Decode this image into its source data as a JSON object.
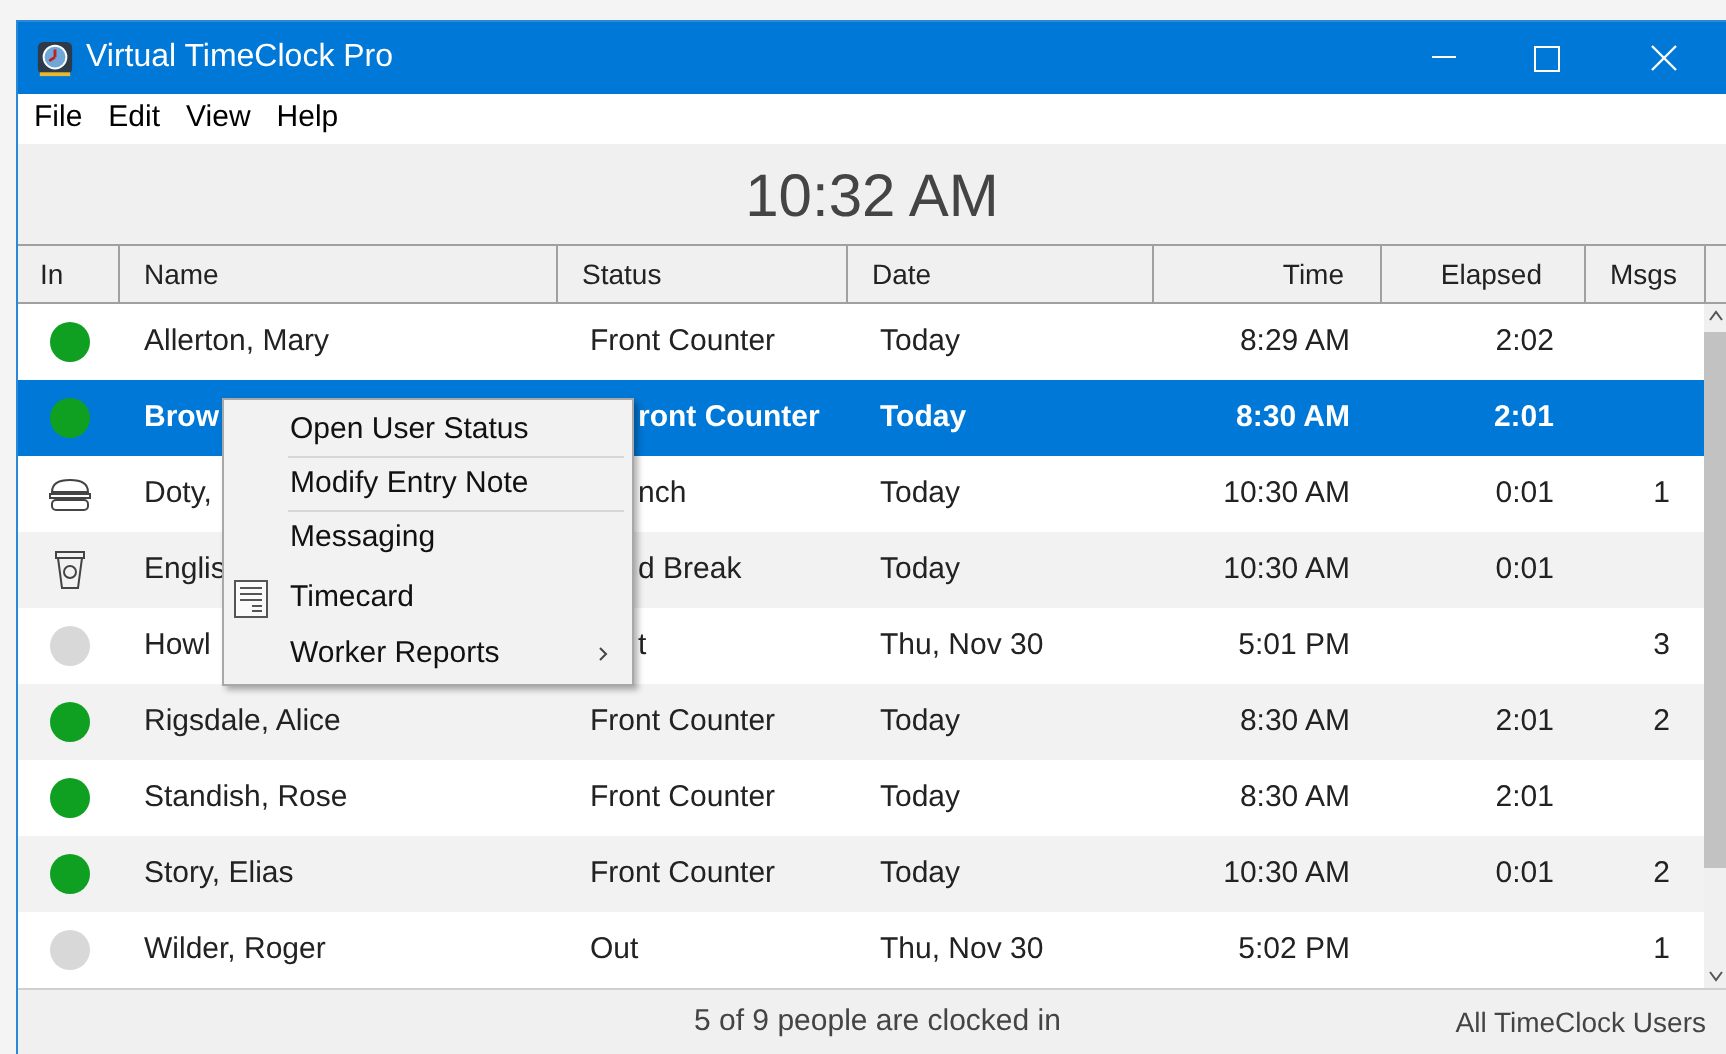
{
  "window": {
    "title": "Virtual TimeClock Pro"
  },
  "menu_bar": [
    "File",
    "Edit",
    "View",
    "Help"
  ],
  "clock": "10:32 AM",
  "table": {
    "columns": [
      "In",
      "Name",
      "Status",
      "Date",
      "Time",
      "Elapsed",
      "Msgs"
    ],
    "rows": [
      {
        "kind": "in",
        "name": "Allerton, Mary",
        "status": "Front Counter",
        "date": "Today",
        "time": "8:29 AM",
        "elapsed": "2:02",
        "msgs": "",
        "selected": false
      },
      {
        "kind": "in",
        "name": "Brow",
        "status": "ront Counter",
        "date": "Today",
        "time": "8:30 AM",
        "elapsed": "2:01",
        "msgs": "",
        "selected": true
      },
      {
        "kind": "lunch",
        "name": "Doty,",
        "status": "nch",
        "date": "Today",
        "time": "10:30 AM",
        "elapsed": "0:01",
        "msgs": "1",
        "selected": false
      },
      {
        "kind": "break",
        "name": "Englis",
        "status": "d Break",
        "date": "Today",
        "time": "10:30 AM",
        "elapsed": "0:01",
        "msgs": "",
        "selected": false
      },
      {
        "kind": "out",
        "name": "Howl",
        "status": "t",
        "date": "Thu, Nov 30",
        "time": "5:01 PM",
        "elapsed": "",
        "msgs": "3",
        "selected": false
      },
      {
        "kind": "in",
        "name": "Rigsdale, Alice",
        "status": "Front Counter",
        "date": "Today",
        "time": "8:30 AM",
        "elapsed": "2:01",
        "msgs": "2",
        "selected": false
      },
      {
        "kind": "in",
        "name": "Standish, Rose",
        "status": "Front Counter",
        "date": "Today",
        "time": "8:30 AM",
        "elapsed": "2:01",
        "msgs": "",
        "selected": false
      },
      {
        "kind": "in",
        "name": "Story, Elias",
        "status": "Front Counter",
        "date": "Today",
        "time": "10:30 AM",
        "elapsed": "0:01",
        "msgs": "2",
        "selected": false
      },
      {
        "kind": "out",
        "name": "Wilder, Roger",
        "status": "Out",
        "date": "Thu, Nov 30",
        "time": "5:02 PM",
        "elapsed": "",
        "msgs": "1",
        "selected": false
      }
    ]
  },
  "context_menu": [
    {
      "label": "Open User Status"
    },
    {
      "label": "Modify Entry Note"
    },
    {
      "label": "Messaging"
    },
    {
      "label": "Timecard",
      "kind": "timecard"
    },
    {
      "label": "Worker Reports",
      "kind": "submenu"
    }
  ],
  "status_bar": {
    "summary": "5 of 9 people are clocked in",
    "filter": "All TimeClock Users"
  }
}
